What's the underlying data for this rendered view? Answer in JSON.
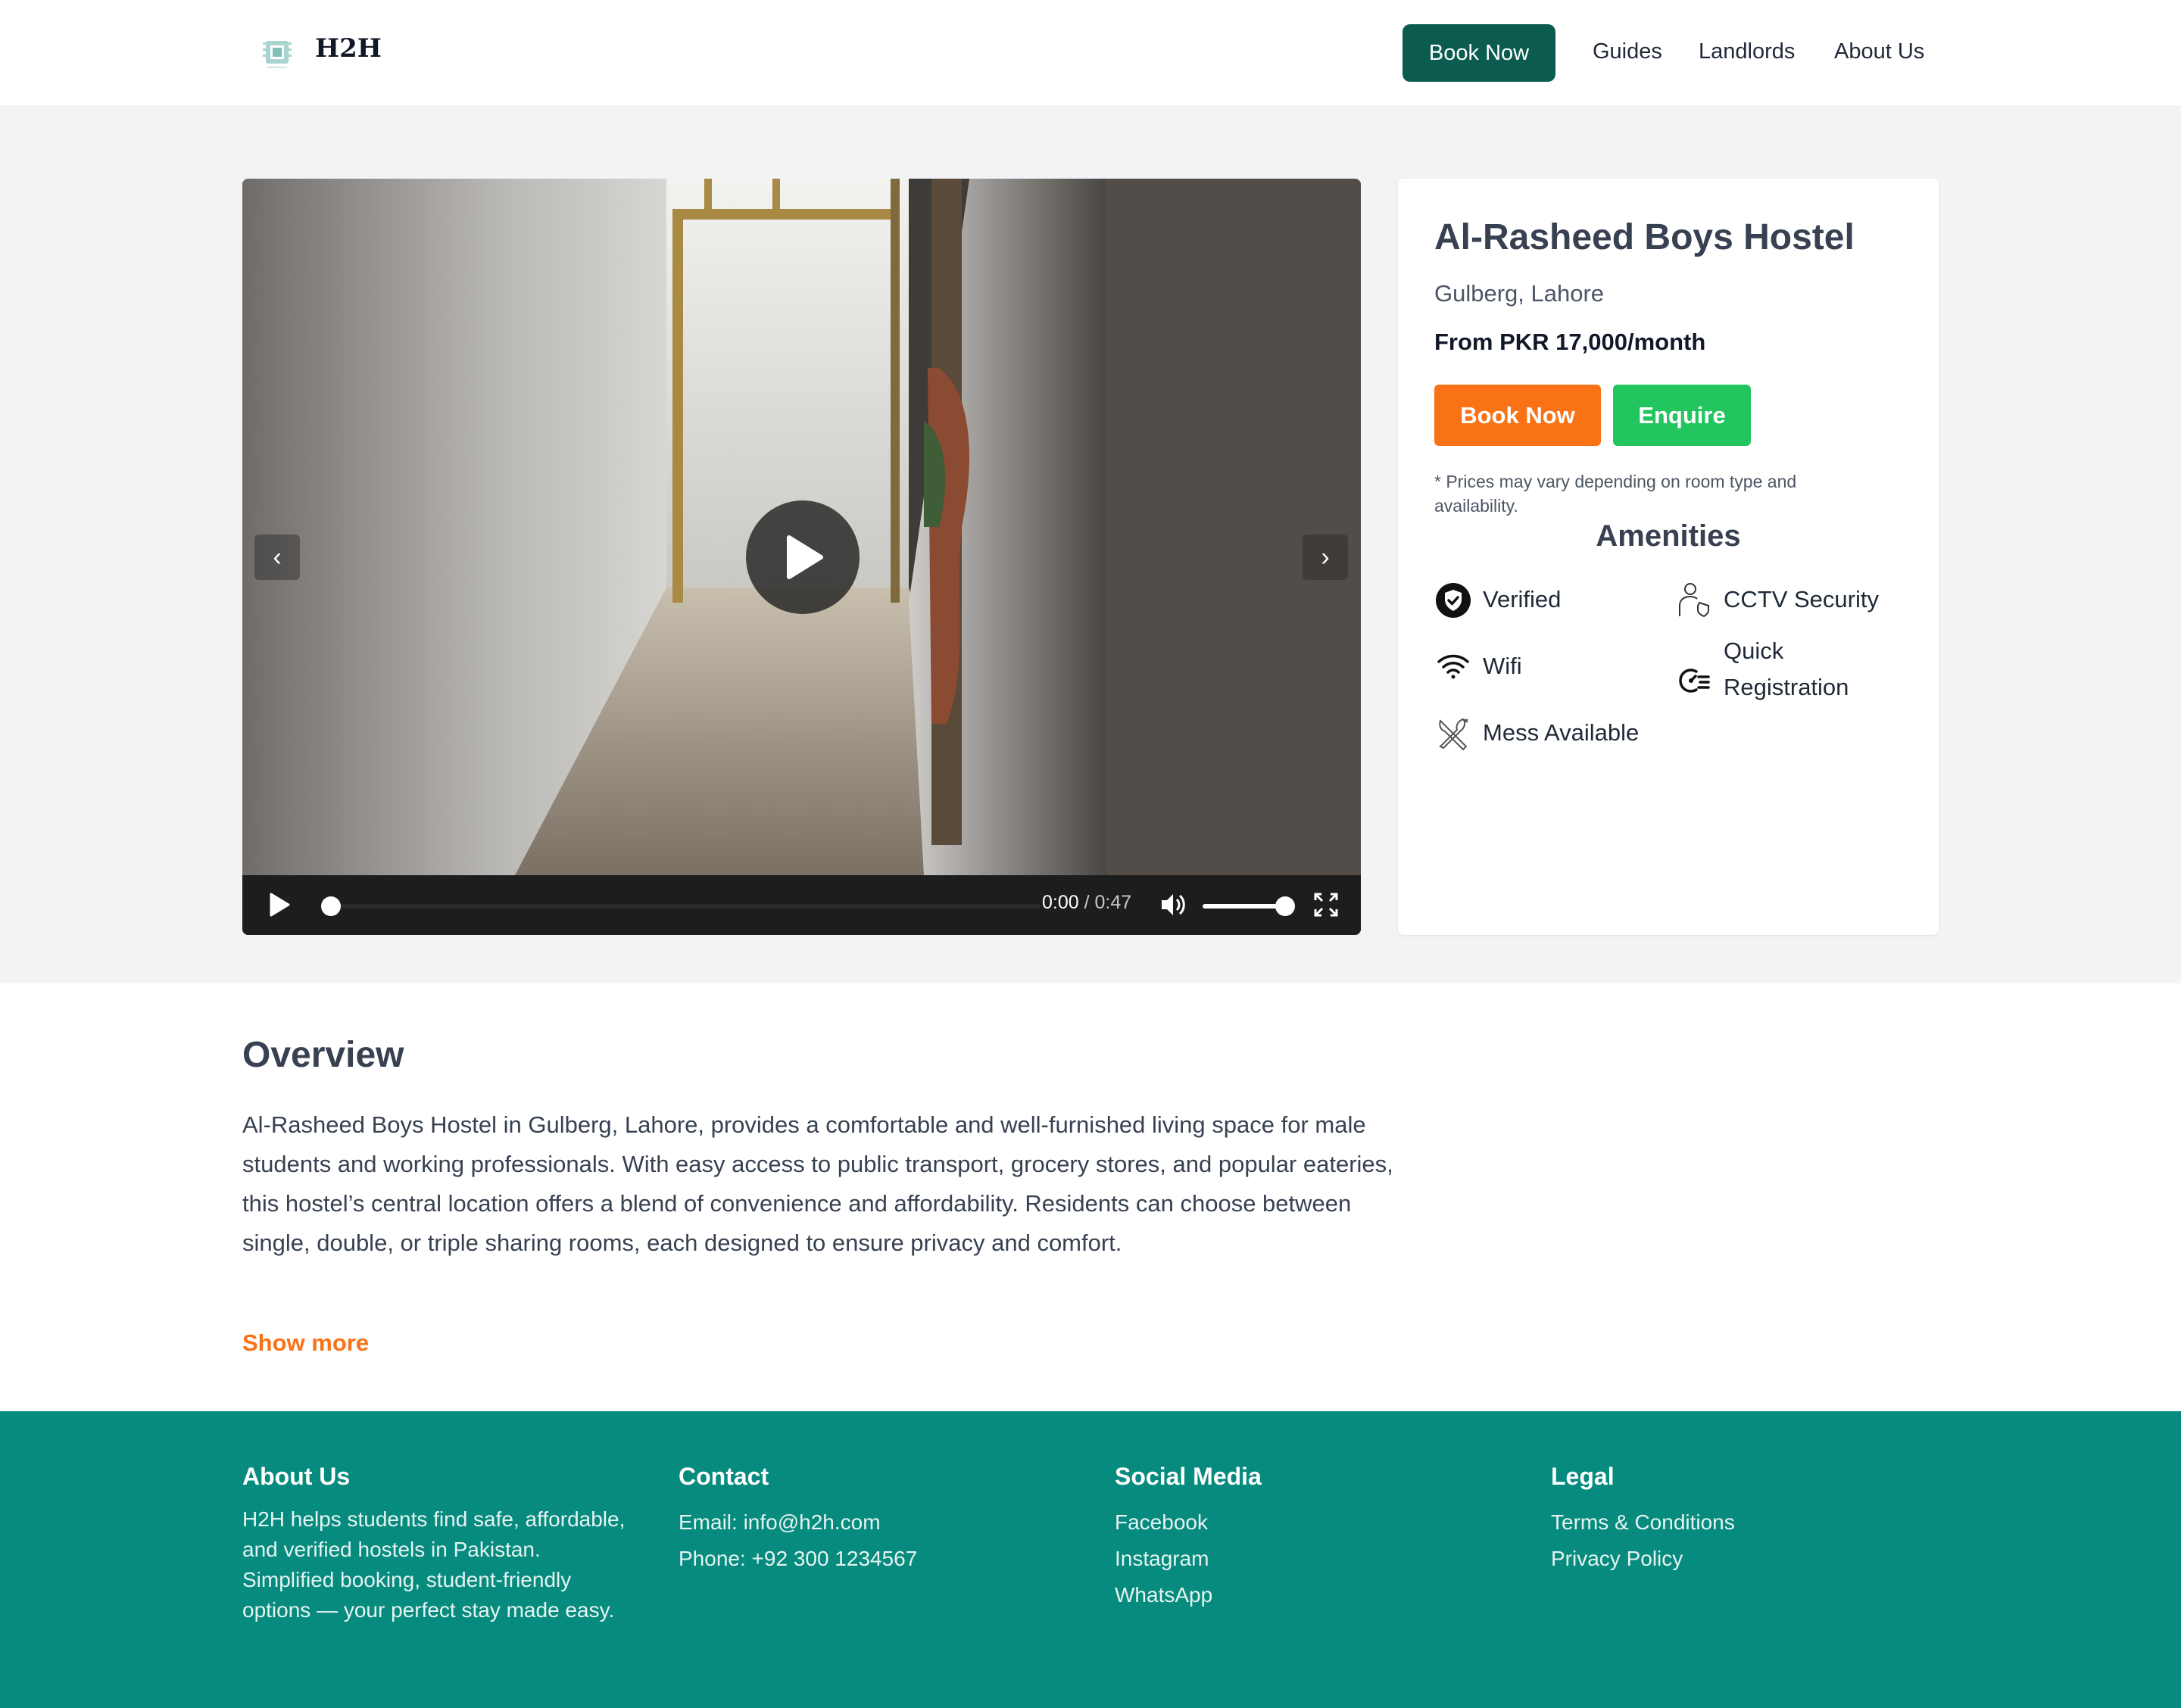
{
  "header": {
    "brand": "H2H",
    "book_now": "Book Now",
    "nav": [
      "Guides",
      "Landlords",
      "About Us"
    ]
  },
  "video": {
    "prev": "‹",
    "next": "›",
    "current_time": "0:00",
    "duration": "/ 0:47",
    "progress": 0,
    "volume": 1
  },
  "hostel": {
    "name": "Al-Rasheed Boys Hostel",
    "location": "Gulberg, Lahore",
    "price": "From PKR 17,000/month",
    "book_label": "Book Now",
    "enquire_label": "Enquire",
    "note": "* Prices may vary depending on room type and availability.",
    "amenities_title": "Amenities",
    "amenities": [
      {
        "label": "Verified",
        "icon": "verified-badge-icon"
      },
      {
        "label": "CCTV Security",
        "icon": "cctv-security-icon"
      },
      {
        "label": "Wifi",
        "icon": "wifi-icon"
      },
      {
        "label": "Quick Registration",
        "icon": "quick-registration-icon"
      },
      {
        "label": "Mess Available",
        "icon": "fork-knife-icon"
      }
    ]
  },
  "overview": {
    "title": "Overview",
    "text": "Al-Rasheed Boys Hostel in Gulberg, Lahore, provides a comfortable and well-furnished living space for male students and working professionals. With easy access to public transport, grocery stores, and popular eateries, this hostel’s central location offers a blend of convenience and affordability. Residents can choose between single, double, or triple sharing rooms, each designed to ensure privacy and comfort.",
    "show_more": "Show more"
  },
  "footer": {
    "about": {
      "title": "About Us",
      "text": "H2H helps students find safe, affordable, and verified hostels in Pakistan. Simplified booking, student-friendly options — your perfect stay made easy."
    },
    "contact": {
      "title": "Contact",
      "email": "Email: info@h2h.com",
      "phone": "Phone: +92 300 1234567"
    },
    "social": {
      "title": "Social Media",
      "items": [
        "Facebook",
        "Instagram",
        "WhatsApp"
      ]
    },
    "legal": {
      "title": "Legal",
      "items": [
        "Terms & Conditions",
        "Privacy Policy"
      ]
    }
  },
  "colors": {
    "brand_dark": "#0b5c4f",
    "accent_orange": "#f97316",
    "accent_green": "#22c55e",
    "footer_teal": "#068b7e"
  }
}
